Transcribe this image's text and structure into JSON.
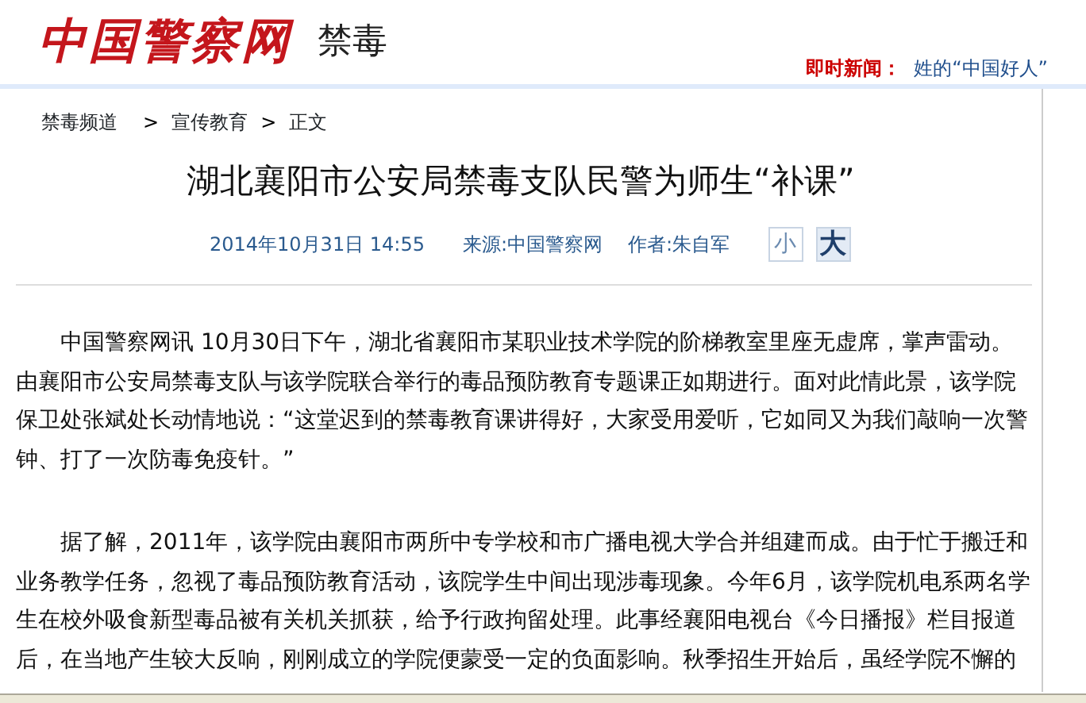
{
  "header": {
    "logo": "中国警察网",
    "channel": "禁毒",
    "ticker_label": "即时新闻：",
    "ticker_items": [
      "姓的“中国好人”"
    ]
  },
  "breadcrumb": [
    {
      "label": "禁毒频道"
    },
    {
      "label": "宣传教育"
    },
    {
      "label": "正文"
    }
  ],
  "breadcrumb_separators": [
    ">",
    ">"
  ],
  "article": {
    "title": "湖北襄阳市公安局禁毒支队民警为师生“补课”",
    "date": "2014年10月31日 14:55",
    "source": "来源:中国警察网",
    "author": "作者:朱自军",
    "font_sizes": [
      {
        "label": "小",
        "selected": false
      },
      {
        "label": "大",
        "selected": true
      }
    ],
    "paragraphs": [
      "中国警察网讯 10月30日下午，湖北省襄阳市某职业技术学院的阶梯教室里座无虚席，掌声雷动。由襄阳市公安局禁毒支队与该学院联合举行的毒品预防教育专题课正如期进行。面对此情此景，该学院保卫处张斌处长动情地说：“这堂迟到的禁毒教育课讲得好，大家受用爱听，它如同又为我们敲响一次警钟、打了一次防毒免疫针。”",
      "据了解，2011年，该学院由襄阳市两所中专学校和市广播电视大学合并组建而成。由于忙于搬迁和业务教学任务，忽视了毒品预防教育活动，该院学生中间出现涉毒现象。今年6月，该学院机电系两名学生在校外吸食新型毒品被有关机关抓获，给予行政拘留处理。此事经襄阳电视台《今日播报》栏目报道后，在当地产生较大反响，刚刚成立的学院便蒙受一定的负面影响。秋季招生开始后，虽经学院不懈的"
    ]
  }
}
